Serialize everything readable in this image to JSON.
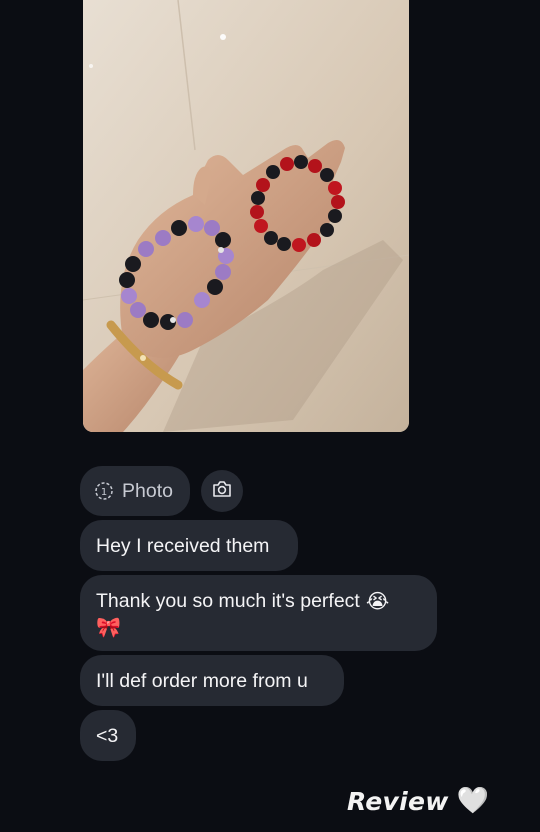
{
  "messages": {
    "photo_pill": {
      "icon": "view-once-icon",
      "label": "Photo"
    },
    "camera_button": {
      "icon": "camera-icon"
    },
    "items": [
      {
        "text": "Hey I received them"
      },
      {
        "text": "Thank you so much it's perfect",
        "emoji_1": "😭",
        "emoji_2": "🎀"
      },
      {
        "text": "I'll def order more from u"
      },
      {
        "text": "<3"
      }
    ]
  },
  "caption": {
    "text": "Review",
    "heart": "🤍"
  },
  "colors": {
    "background": "#0b0d13",
    "bubble": "#262a33",
    "text": "#f4f4f6"
  }
}
